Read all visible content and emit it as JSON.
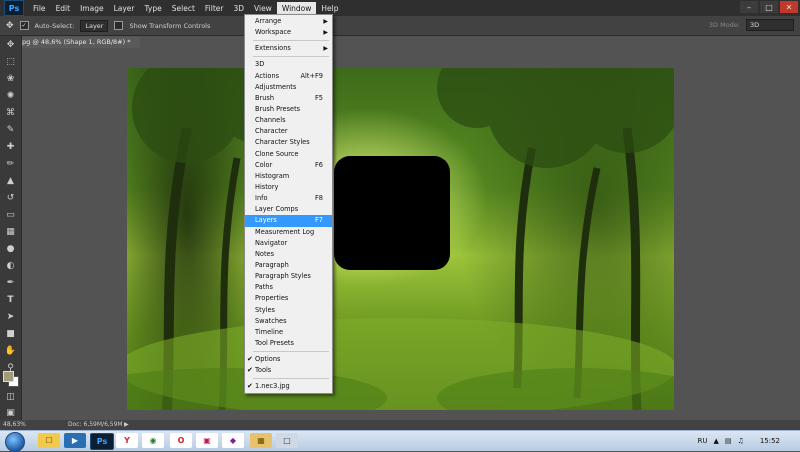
{
  "menubar": {
    "logo": "Ps",
    "items": [
      "File",
      "Edit",
      "Image",
      "Layer",
      "Type",
      "Select",
      "Filter",
      "3D",
      "View",
      "Window",
      "Help"
    ],
    "active": "Window"
  },
  "options": {
    "auto_select_label": "Auto-Select:",
    "auto_select_value": "Layer",
    "show_transform_label": "Show Transform Controls",
    "mode_3d_label": "3D Mode:",
    "workspace_value": "3D"
  },
  "document_tab": {
    "title": "pg @ 48,6% (Shape 1, RGB/8#) *"
  },
  "window_menu": {
    "items": [
      {
        "label": "Arrange",
        "submenu": true
      },
      {
        "label": "Workspace",
        "submenu": true
      },
      {
        "sep": true
      },
      {
        "label": "Extensions",
        "submenu": true
      },
      {
        "sep": true
      },
      {
        "label": "3D"
      },
      {
        "label": "Actions",
        "shortcut": "Alt+F9"
      },
      {
        "label": "Adjustments"
      },
      {
        "label": "Brush",
        "shortcut": "F5"
      },
      {
        "label": "Brush Presets"
      },
      {
        "label": "Channels"
      },
      {
        "label": "Character"
      },
      {
        "label": "Character Styles"
      },
      {
        "label": "Clone Source"
      },
      {
        "label": "Color",
        "shortcut": "F6"
      },
      {
        "label": "Histogram"
      },
      {
        "label": "History"
      },
      {
        "label": "Info",
        "shortcut": "F8"
      },
      {
        "label": "Layer Comps"
      },
      {
        "label": "Layers",
        "shortcut": "F7",
        "highlighted": true
      },
      {
        "label": "Measurement Log"
      },
      {
        "label": "Navigator"
      },
      {
        "label": "Notes"
      },
      {
        "label": "Paragraph"
      },
      {
        "label": "Paragraph Styles"
      },
      {
        "label": "Paths"
      },
      {
        "label": "Properties"
      },
      {
        "label": "Styles"
      },
      {
        "label": "Swatches"
      },
      {
        "label": "Timeline"
      },
      {
        "label": "Tool Presets"
      },
      {
        "sep": true
      },
      {
        "label": "Options",
        "checked": true
      },
      {
        "label": "Tools",
        "checked": true
      },
      {
        "sep": true
      },
      {
        "label": "1.nec3.jpg",
        "checked": true
      }
    ]
  },
  "status": {
    "zoom": "48,63%",
    "doc": "Doc: 6,59M/6,59M"
  },
  "taskbar": {
    "language": "RU",
    "time": "15:52"
  },
  "colors": {
    "foreground_swatch": "#a19b7a",
    "background_swatch": "#ffffff",
    "menu_highlight": "#3399ff"
  }
}
